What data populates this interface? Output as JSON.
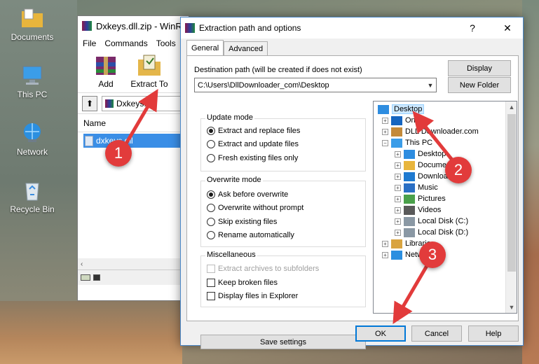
{
  "desktop": {
    "icons": [
      {
        "label": "Documents",
        "icon": "documents-folder-icon"
      },
      {
        "label": "This PC",
        "icon": "this-pc-icon"
      },
      {
        "label": "Network",
        "icon": "network-icon"
      },
      {
        "label": "Recycle Bin",
        "icon": "recycle-bin-icon"
      }
    ]
  },
  "winrar": {
    "title": "Dxkeys.dll.zip - WinR",
    "menu": [
      "File",
      "Commands",
      "Tools"
    ],
    "tools": [
      {
        "label": "Add"
      },
      {
        "label": "Extract To"
      }
    ],
    "path": "Dxkeys.dll.",
    "column_name": "Name",
    "file": "dxkeys.dll"
  },
  "dialog": {
    "title": "Extraction path and options",
    "help_button": "?",
    "close_button": "✕",
    "tabs": [
      "General",
      "Advanced"
    ],
    "destination_label": "Destination path (will be created if does not exist)",
    "destination_value": "C:\\Users\\DllDownloader_com\\Desktop",
    "display_button": "Display",
    "new_folder_button": "New Folder",
    "update_mode": {
      "title": "Update mode",
      "options": [
        "Extract and replace files",
        "Extract and update files",
        "Fresh existing files only"
      ],
      "selected": 0
    },
    "overwrite_mode": {
      "title": "Overwrite mode",
      "options": [
        "Ask before overwrite",
        "Overwrite without prompt",
        "Skip existing files",
        "Rename automatically"
      ],
      "selected": 0
    },
    "miscellaneous": {
      "title": "Miscellaneous",
      "options": [
        {
          "label": "Extract archives to subfolders",
          "checked": false,
          "disabled": true
        },
        {
          "label": "Keep broken files",
          "checked": false,
          "disabled": false
        },
        {
          "label": "Display files in Explorer",
          "checked": false,
          "disabled": false
        }
      ]
    },
    "save_settings": "Save settings",
    "tree": [
      {
        "label": "Desktop",
        "level": 0,
        "expander": "",
        "selected": true,
        "icon": "desktop-icon"
      },
      {
        "label": "OneDr",
        "level": 1,
        "expander": "+",
        "icon": "onedrive-icon"
      },
      {
        "label": "DLL Downloader.com",
        "level": 1,
        "expander": "+",
        "icon": "user-folder-icon"
      },
      {
        "label": "This PC",
        "level": 1,
        "expander": "−",
        "icon": "this-pc-icon"
      },
      {
        "label": "Desktop",
        "level": 2,
        "expander": "+",
        "icon": "desktop-icon"
      },
      {
        "label": "Documents",
        "level": 2,
        "expander": "+",
        "icon": "documents-icon"
      },
      {
        "label": "Downloads",
        "level": 2,
        "expander": "+",
        "icon": "downloads-icon"
      },
      {
        "label": "Music",
        "level": 2,
        "expander": "+",
        "icon": "music-icon"
      },
      {
        "label": "Pictures",
        "level": 2,
        "expander": "+",
        "icon": "pictures-icon"
      },
      {
        "label": "Videos",
        "level": 2,
        "expander": "+",
        "icon": "videos-icon"
      },
      {
        "label": "Local Disk (C:)",
        "level": 2,
        "expander": "+",
        "icon": "drive-icon"
      },
      {
        "label": "Local Disk (D:)",
        "level": 2,
        "expander": "+",
        "icon": "drive-icon"
      },
      {
        "label": "Librarie",
        "level": 1,
        "expander": "+",
        "icon": "libraries-icon"
      },
      {
        "label": "Network",
        "level": 1,
        "expander": "+",
        "icon": "network-icon"
      }
    ],
    "buttons": {
      "ok": "OK",
      "cancel": "Cancel",
      "help": "Help"
    }
  },
  "annotations": [
    "1",
    "2",
    "3"
  ],
  "colors": {
    "accent": "#0078d7",
    "annotation": "#e23b3b",
    "selection": "#3a8ee6"
  }
}
